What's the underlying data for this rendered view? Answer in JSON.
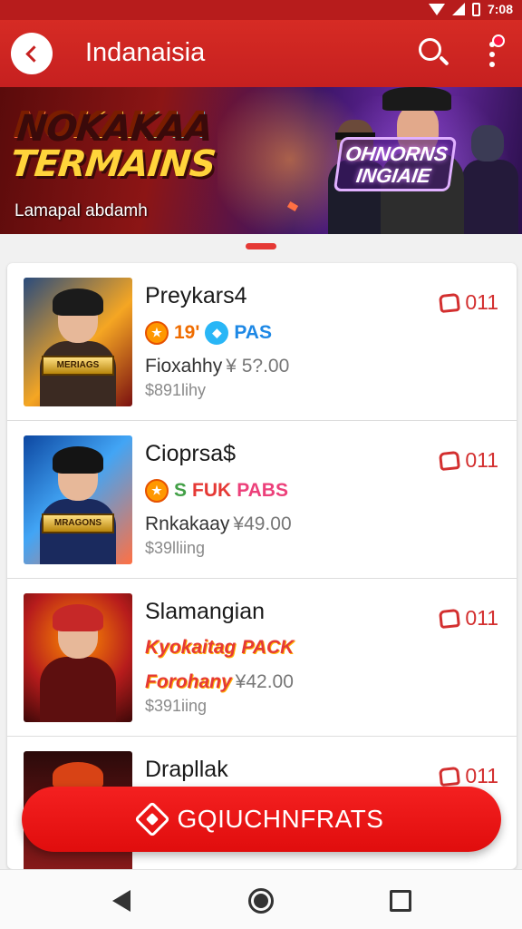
{
  "status_bar": {
    "time": "7:08"
  },
  "appbar": {
    "title": "Indanaisia"
  },
  "banner": {
    "headline_line1": "NOKAKAA",
    "headline_line2": "TERMAINS",
    "subtitle": "Lamapal abdamh",
    "badge_line1": "OHNORNS",
    "badge_line2": "INGIAIE"
  },
  "items": [
    {
      "title": "Preykars4",
      "tags": [
        "19'",
        "PAS"
      ],
      "price_label": "Fioxahhy",
      "price": "¥ 5?.00",
      "sold": "$891lihy",
      "likes": "011",
      "thumb_plate": "MERIAGS"
    },
    {
      "title": "Cioprsa$",
      "tags": [
        "S",
        "FUK",
        "PABS"
      ],
      "price_label": "Rnkakaay",
      "price": "¥49.00",
      "sold": "$39lliing",
      "likes": "011",
      "thumb_plate": "MRAGONS"
    },
    {
      "title": "Slamangian",
      "tags": [
        "Kyokaitag",
        "PACK"
      ],
      "price_label": "Forohany",
      "price": "¥42.00",
      "sold": "$391iing",
      "likes": "011",
      "thumb_plate": ""
    },
    {
      "title": "Drapllak",
      "likes": "011"
    }
  ],
  "cta": {
    "label": "GQIUCHNFRATS"
  },
  "colors": {
    "primary": "#d62b24",
    "cta": "#f01616",
    "like": "#d32f2f"
  },
  "icons": [
    "back-icon",
    "search-icon",
    "more-icon",
    "heart-icon",
    "tag-icon",
    "nav-back-icon",
    "nav-home-icon",
    "nav-recent-icon"
  ]
}
